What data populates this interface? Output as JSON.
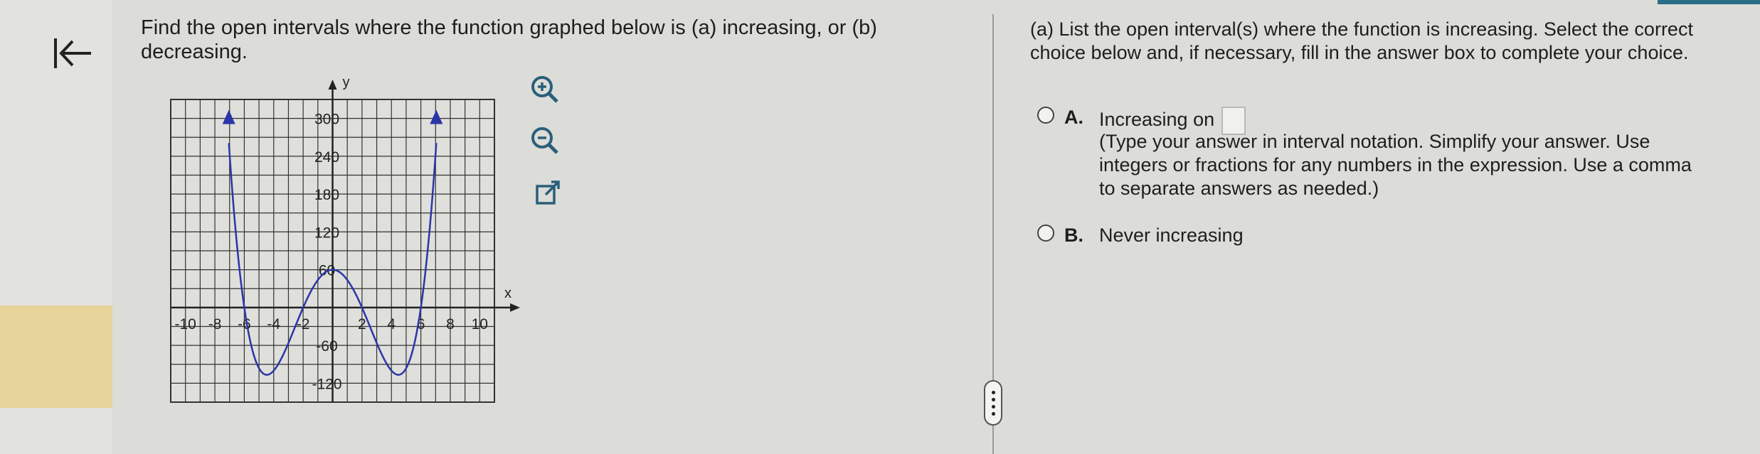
{
  "question": {
    "text_part1": "Find the open intervals where the function graphed below is ",
    "label_a": "(a)",
    "text_part2": " increasing, or ",
    "label_b": "(b)",
    "text_part3": " decreasing."
  },
  "graph": {
    "axis_x_label": "x",
    "axis_y_label": "y",
    "x_ticks": [
      "-10",
      "-8",
      "-6",
      "-4",
      "-2",
      "2",
      "4",
      "6",
      "8",
      "10"
    ],
    "y_ticks": [
      "300",
      "240",
      "180",
      "120",
      "60",
      "-60",
      "-120"
    ],
    "curve_color": "#2a36a8"
  },
  "tools": {
    "zoom_in": "zoom-in-icon",
    "zoom_out": "zoom-out-icon",
    "popout": "external-link-icon"
  },
  "part_a": {
    "prompt": "(a) List the open interval(s) where the function is increasing. Select the correct choice below and, if necessary, fill in the answer box to complete your choice.",
    "option_a_letter": "A.",
    "option_a_text": "Increasing on",
    "option_a_hint": "(Type your answer in interval notation. Simplify your answer. Use integers or fractions for any numbers in the expression. Use a comma to separate answers as needed.)",
    "option_b_letter": "B.",
    "option_b_text": "Never increasing"
  }
}
